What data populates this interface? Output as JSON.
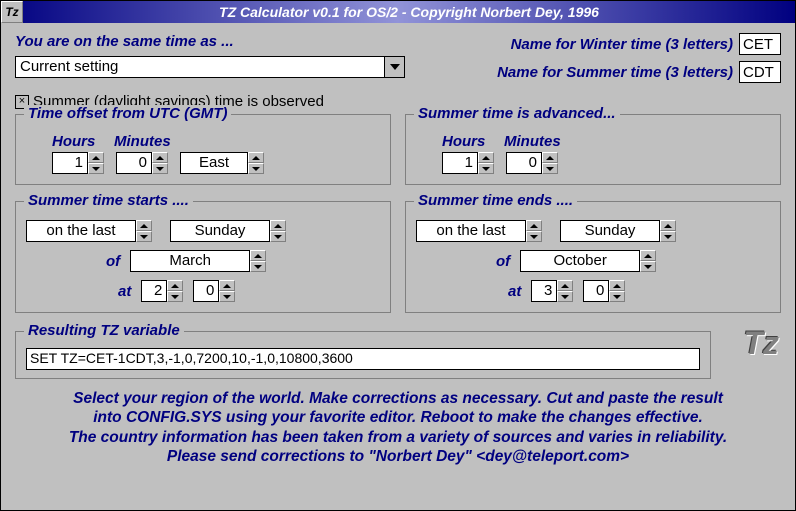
{
  "window": {
    "title": "TZ Calculator v0.1 for OS/2 - Copyright Norbert Dey, 1996",
    "sysmenu": "Tz"
  },
  "top": {
    "timeAsLabel": "You are on the same time as ...",
    "regionSelector": "Current setting",
    "winterNameLabel": "Name for Winter time (3 letters)",
    "summerNameLabel": "Name for Summer time (3 letters)",
    "winterName": "CET",
    "summerName": "CDT"
  },
  "dst": {
    "checkbox": "×",
    "label": "Summer (daylight savings) time is observed"
  },
  "utc": {
    "legend": "Time offset from UTC (GMT)",
    "hoursLabel": "Hours",
    "minutesLabel": "Minutes",
    "hours": "1",
    "minutes": "0",
    "direction": "East"
  },
  "adv": {
    "legend": "Summer time is advanced...",
    "hours": "1",
    "minutes": "0"
  },
  "start": {
    "legend": "Summer time starts ....",
    "ordinal": "on the last",
    "weekday": "Sunday",
    "ofLabel": "of",
    "month": "March",
    "atLabel": "at",
    "atHours": "2",
    "atMinutes": "0"
  },
  "end": {
    "legend": "Summer time ends ....",
    "ordinal": "on the last",
    "weekday": "Sunday",
    "ofLabel": "of",
    "month": "October",
    "atLabel": "at",
    "atHours": "3",
    "atMinutes": "0"
  },
  "result": {
    "legend": "Resulting TZ variable",
    "value": "SET TZ=CET-1CDT,3,-1,0,7200,10,-1,0,10800,3600",
    "logo": "Tz"
  },
  "help": {
    "line1": "Select your region of the world. Make corrections as necessary. Cut and paste the result",
    "line2": "into CONFIG.SYS using your favorite editor.  Reboot to make the changes effective.",
    "line3": "The country information has been taken from a variety of sources and varies in reliability.",
    "line4": "Please send corrections to \"Norbert Dey\" <dey@teleport.com>"
  }
}
